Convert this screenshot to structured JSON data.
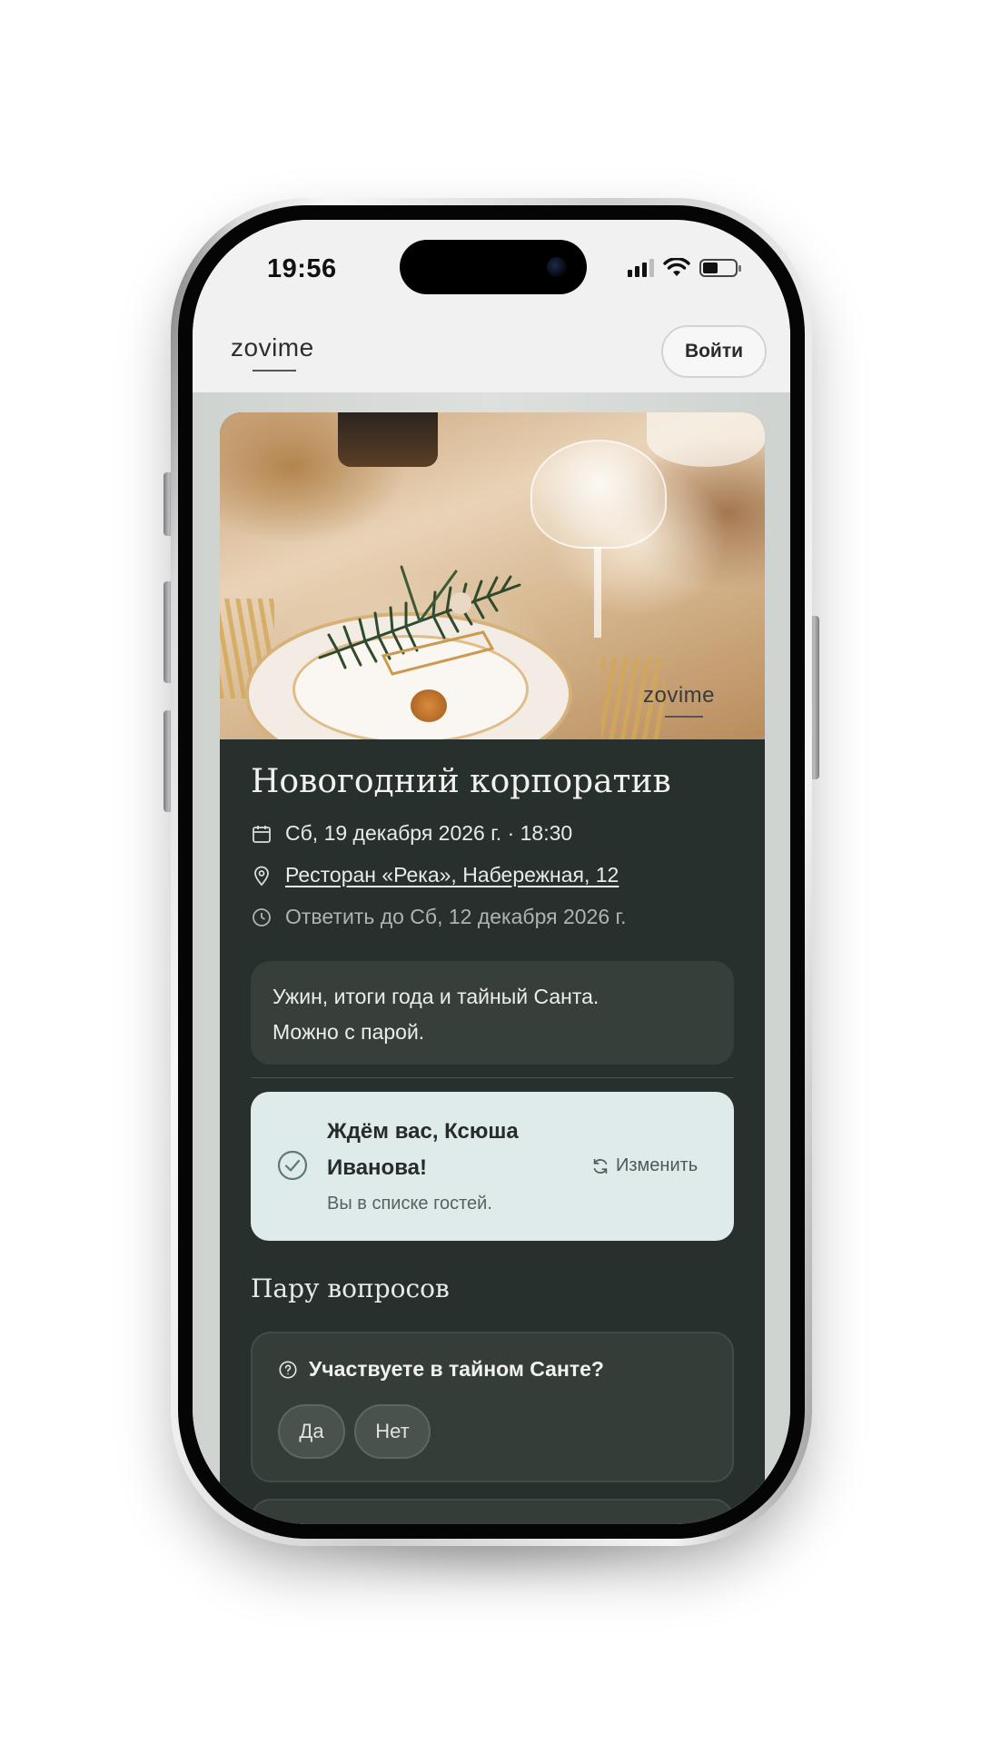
{
  "status_bar": {
    "time": "19:56"
  },
  "header": {
    "logo": "zovime",
    "login_label": "Войти"
  },
  "event": {
    "hero_watermark": "zovime",
    "title": "Новогодний корпоратив",
    "date": "Сб, 19 декабря 2026 г. · 18:30",
    "place": "Ресторан «Река», Набережная, 12",
    "deadline": "Ответить до Сб, 12 декабря 2026 г.",
    "note_line1": "Ужин, итоги года и тайный Санта.",
    "note_line2": "Можно с парой."
  },
  "rsvp": {
    "title": "Ждём вас, Ксюша Иванова!",
    "subtitle": "Вы в списке гостей.",
    "change_label": "Изменить"
  },
  "questions": {
    "section_title": "Пару вопросов",
    "items": [
      {
        "text": "Участвуете в тайном Санте?",
        "options": [
          "Да",
          "Нет"
        ]
      }
    ]
  },
  "colors": {
    "card_bg": "#27302c",
    "rsvp_bg": "#dfeaea",
    "header_bg": "#f1f1f1",
    "accent_check": "#5f7a74"
  },
  "icons": {
    "date": "calendar-icon",
    "place": "map-pin-icon",
    "deadline": "clock-icon",
    "rsvp": "check-circle-icon",
    "change": "refresh-icon",
    "question": "question-circle-icon"
  }
}
